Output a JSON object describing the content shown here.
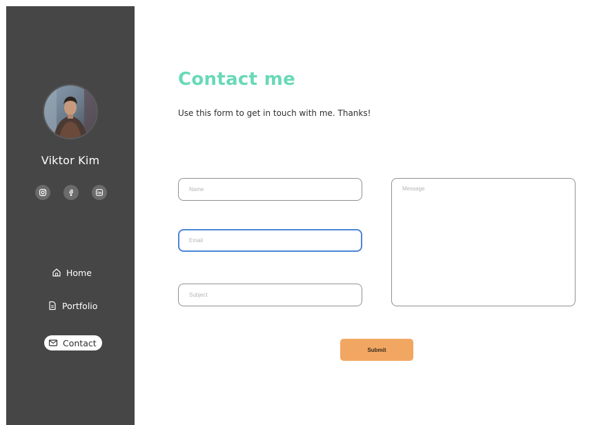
{
  "profile": {
    "name": "Viktor Kim"
  },
  "socials": [
    {
      "icon": "instagram-icon"
    },
    {
      "icon": "facebook-icon"
    },
    {
      "icon": "linkedin-icon"
    }
  ],
  "nav": {
    "items": [
      {
        "label": "Home",
        "icon": "home-icon"
      },
      {
        "label": "Portfolio",
        "icon": "document-icon"
      },
      {
        "label": "Contact",
        "icon": "mail-icon",
        "active": true
      }
    ]
  },
  "main": {
    "title": "Contact me",
    "subtitle": "Use this form to get in touch with me. Thanks!"
  },
  "form": {
    "name_placeholder": "Name",
    "email_placeholder": "Email",
    "subject_placeholder": "Subject",
    "message_placeholder": "Message",
    "submit_label": "Submit"
  },
  "colors": {
    "sidebar_bg": "#464646",
    "accent": "#6ad9b8",
    "submit_bg": "#f1a762",
    "focus_border": "#4a86d6"
  }
}
